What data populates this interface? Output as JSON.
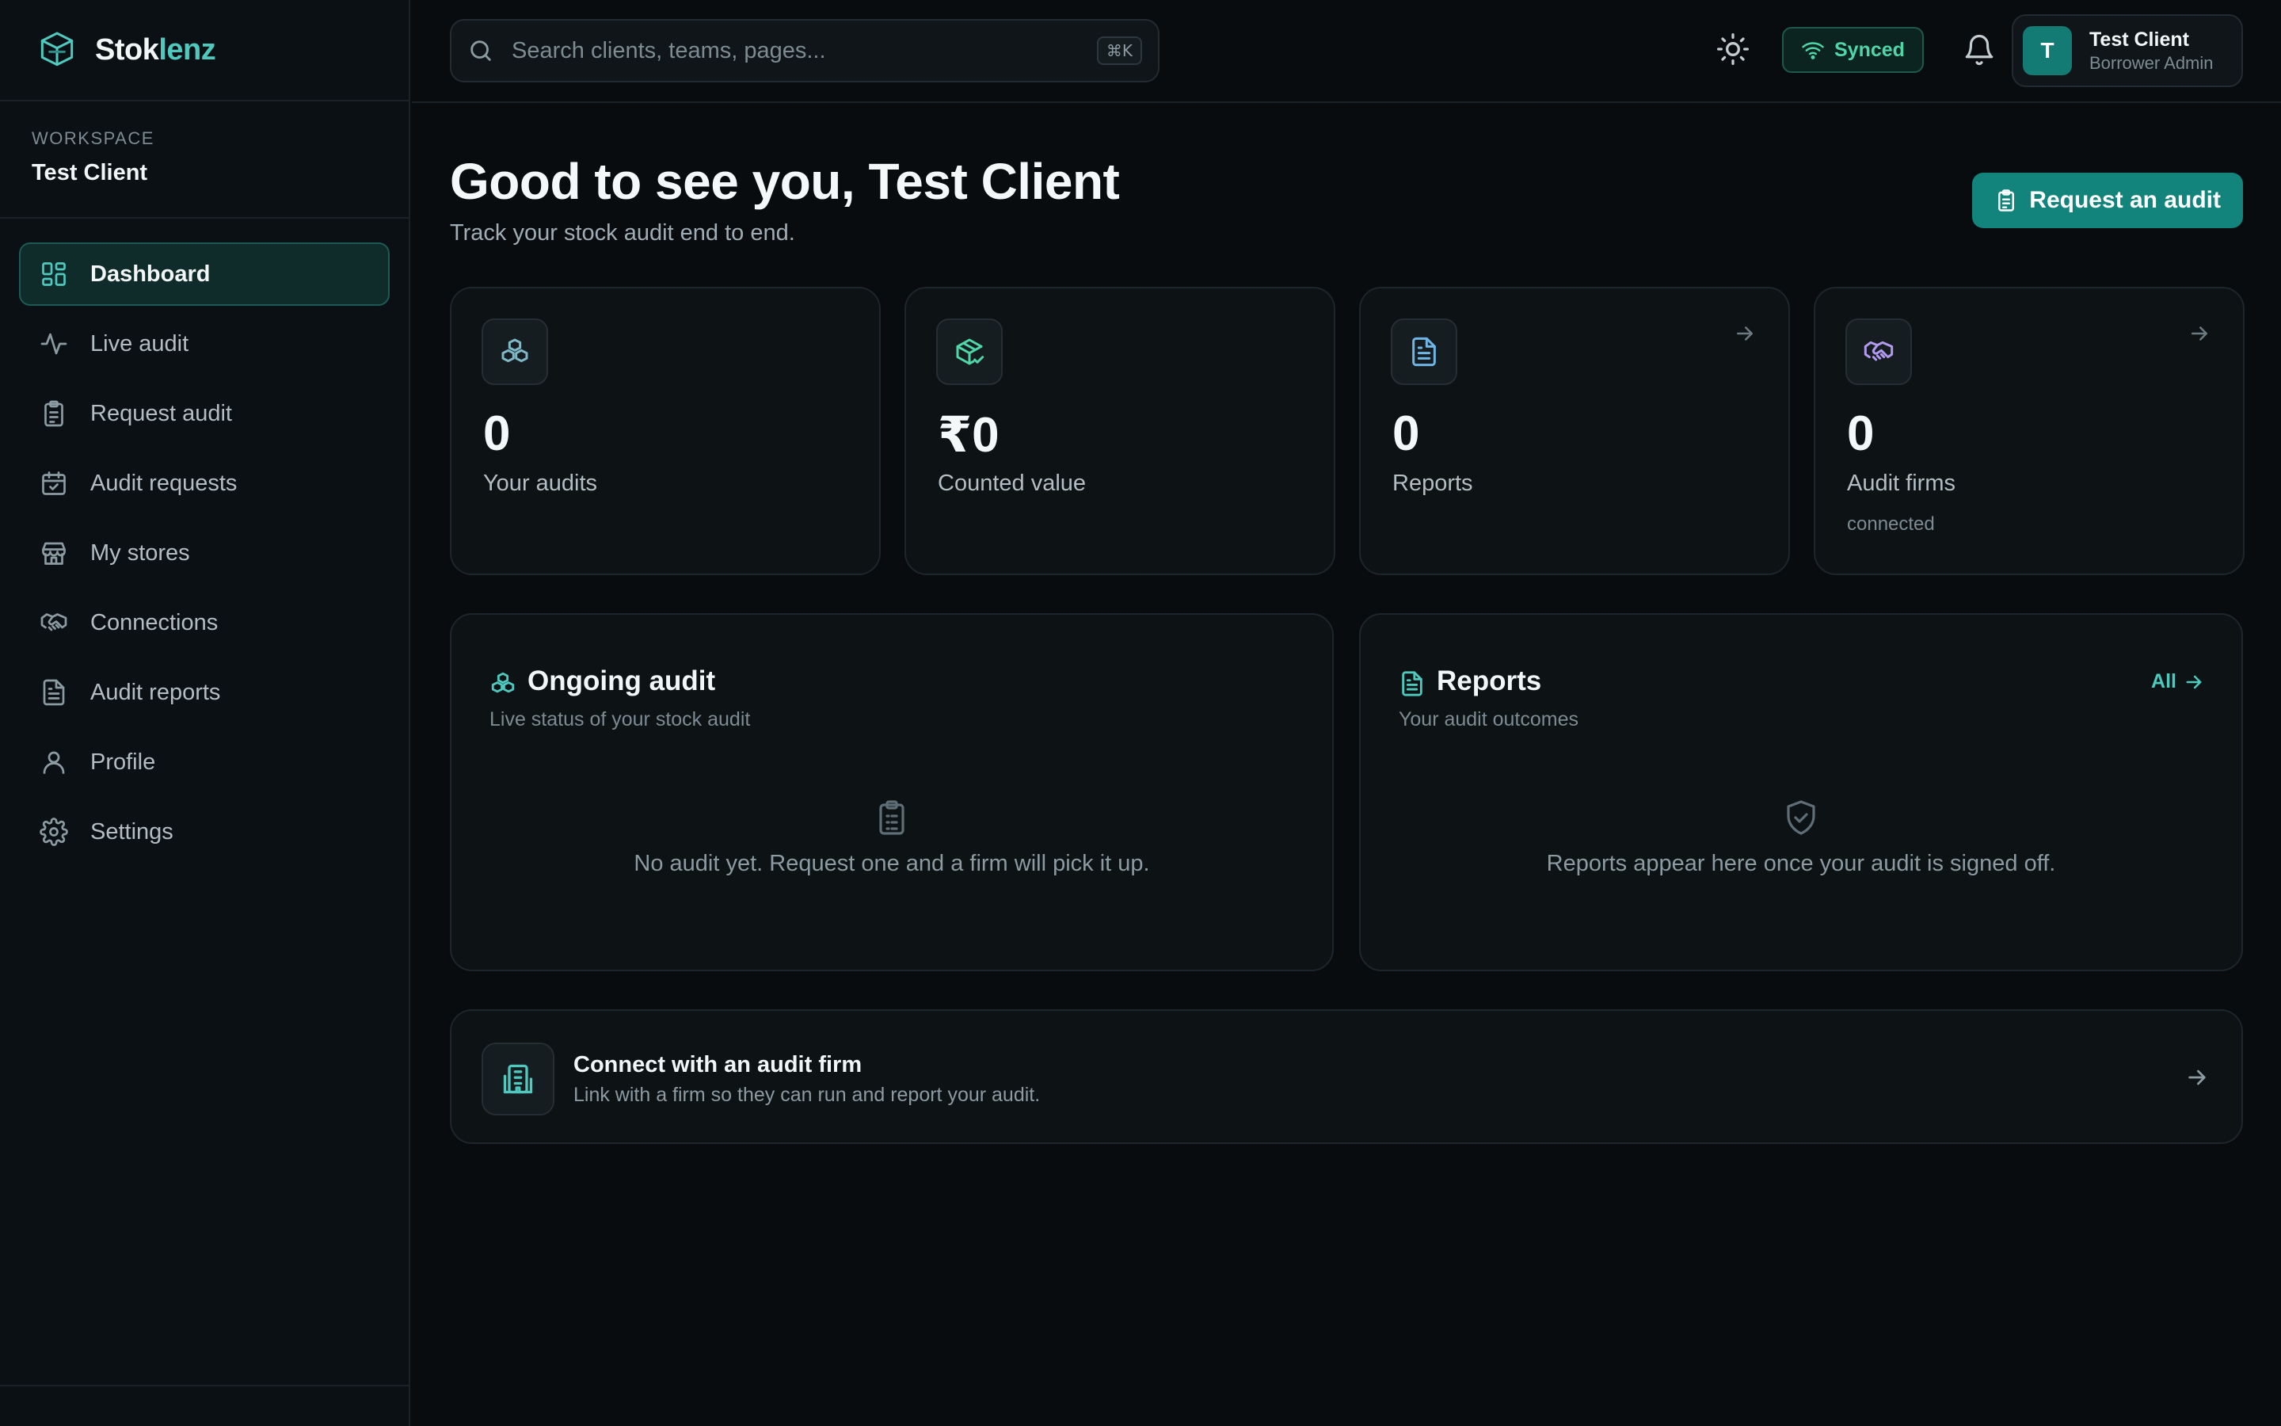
{
  "brand": {
    "name_part1": "Stok",
    "name_part2": "lenz"
  },
  "workspace": {
    "label": "WORKSPACE",
    "name": "Test Client"
  },
  "sidebar": {
    "items": [
      {
        "label": "Dashboard",
        "icon": "dashboard-icon",
        "active": true
      },
      {
        "label": "Live audit",
        "icon": "activity-icon"
      },
      {
        "label": "Request audit",
        "icon": "clipboard-icon"
      },
      {
        "label": "Audit requests",
        "icon": "calendar-check-icon"
      },
      {
        "label": "My stores",
        "icon": "store-icon"
      },
      {
        "label": "Connections",
        "icon": "handshake-icon"
      },
      {
        "label": "Audit reports",
        "icon": "file-text-icon"
      },
      {
        "label": "Profile",
        "icon": "user-icon"
      },
      {
        "label": "Settings",
        "icon": "gear-icon"
      }
    ]
  },
  "topbar": {
    "search_placeholder": "Search clients, teams, pages...",
    "search_shortcut": "⌘K",
    "sync_status": "Synced",
    "user_name": "Test Client",
    "user_role": "Borrower Admin",
    "user_initial": "T"
  },
  "header": {
    "greeting": "Good to see you, Test Client",
    "subtitle": "Track your stock audit end to end.",
    "cta_label": "Request an audit"
  },
  "stats": [
    {
      "value": "0",
      "label": "Your audits",
      "icon": "boxes-icon",
      "icon_color": "#7fb8c7"
    },
    {
      "value": "₹0",
      "label": "Counted value",
      "icon": "package-check-icon",
      "icon_color": "#4fd6a6"
    },
    {
      "value": "0",
      "label": "Reports",
      "icon": "file-text-icon",
      "icon_color": "#6fb6e6"
    },
    {
      "value": "0",
      "label": "Audit firms",
      "sublabel": "connected",
      "icon": "handshake-icon",
      "icon_color": "#b29af0"
    }
  ],
  "ongoing": {
    "title": "Ongoing audit",
    "description": "Live status of your stock audit",
    "empty_text": "No audit yet. Request one and a firm will pick it up."
  },
  "reports": {
    "title": "Reports",
    "description": "Your audit outcomes",
    "all_label": "All",
    "empty_text": "Reports appear here once your audit is signed off."
  },
  "connect": {
    "title": "Connect with an audit firm",
    "description": "Link with a firm so they can run and report your audit."
  },
  "colors": {
    "accent": "#4fc9bd",
    "cta": "#13847c",
    "synced": "#4fd6a6",
    "background": "#080c0f"
  }
}
